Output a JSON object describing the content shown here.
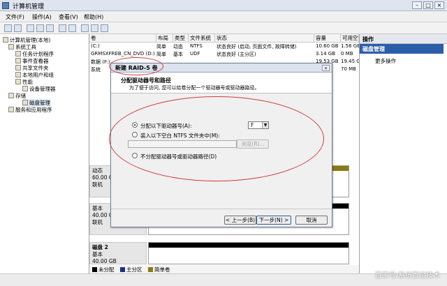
{
  "window": {
    "title": "计算机管理"
  },
  "menu": [
    "文件(F)",
    "操作(A)",
    "查看(V)",
    "帮助(H)"
  ],
  "tree": {
    "root": "计算机管理(本地)",
    "items": [
      {
        "label": "系统工具",
        "indent": 1
      },
      {
        "label": "任务计划程序",
        "indent": 2
      },
      {
        "label": "事件查看器",
        "indent": 2
      },
      {
        "label": "共享文件夹",
        "indent": 2
      },
      {
        "label": "本地用户和组",
        "indent": 2
      },
      {
        "label": "性能",
        "indent": 2
      },
      {
        "label": "设备管理器",
        "indent": 2
      },
      {
        "label": "存储",
        "indent": 1
      },
      {
        "label": "磁盘管理",
        "indent": 2
      },
      {
        "label": "服务和应用程序",
        "indent": 1
      }
    ]
  },
  "volume_table": {
    "headers": [
      "卷",
      "布局",
      "类型",
      "文件系统",
      "状态",
      "容量",
      "可用空"
    ],
    "rows": [
      {
        "name": "(C:)",
        "layout": "简单",
        "type": "动态",
        "fs": "NTFS",
        "status": "状态良好 (启动, 页面文件, 故障转储)",
        "capacity": "10.60 GB",
        "free": "1.56 GB"
      },
      {
        "name": "GRMSXFREB_CN_DVD (D:)",
        "layout": "简单",
        "type": "基本",
        "fs": "UDF",
        "status": "状态良好 (主分区)",
        "capacity": "3.14 GB",
        "free": "0 MB"
      },
      {
        "name": "数据 (F:)",
        "layout": "",
        "type": "",
        "fs": "",
        "status": "",
        "capacity": "19.53 GB",
        "free": "19.45 GB"
      },
      {
        "name": "系统",
        "layout": "",
        "type": "",
        "fs": "",
        "status": "",
        "capacity": "",
        "free": "70 MB"
      }
    ]
  },
  "disks": [
    {
      "name": "",
      "type": "动态",
      "size": "60.00 GB",
      "status": "联机"
    },
    {
      "name": "",
      "type": "基本",
      "size": "40.00 GB",
      "status": "联机"
    },
    {
      "name": "磁盘 2",
      "type": "基本",
      "size": "40.00 GB",
      "status": ""
    }
  ],
  "legend": [
    {
      "label": "未分配",
      "color": "#000000"
    },
    {
      "label": "主分区",
      "color": "#1d2e8a"
    },
    {
      "label": "简单卷",
      "color": "#8a7a12"
    }
  ],
  "actions": {
    "header": "操作",
    "selected": "磁盘管理",
    "more": "更多操作"
  },
  "dialog": {
    "title": "新建 RAID-5 卷",
    "heading": "分配驱动器号和路径",
    "subheading": "为了便于访问, 您可以给卷分配一个驱动器号或驱动器路径。",
    "options": [
      {
        "label": "分配以下驱动器号(A):",
        "selected": true
      },
      {
        "label": "装入以下空白 NTFS 文件夹中(M):",
        "selected": false
      },
      {
        "label": "不分配驱动器号或驱动器路径(D)",
        "selected": false
      }
    ],
    "drive_letter": "F",
    "browse_label": "浏览(R)...",
    "back_label": "< 上一步(B)",
    "next_label": "下一步(N) >",
    "cancel_label": "取消"
  },
  "watermark": "百家号/系统百宝技术"
}
